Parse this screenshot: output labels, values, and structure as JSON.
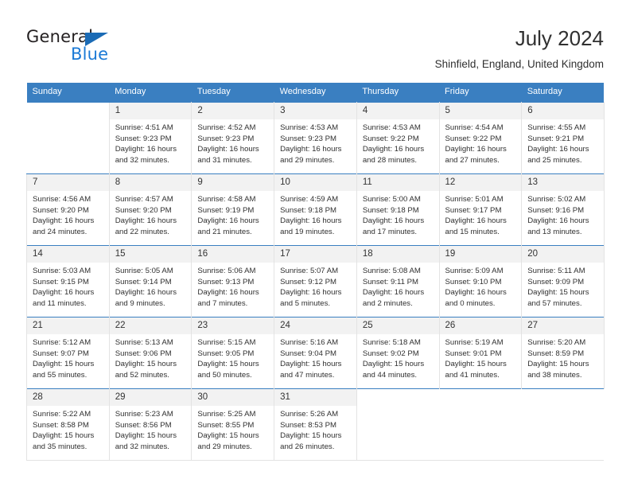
{
  "brand": {
    "word_one": "General",
    "word_two": "Blue",
    "triangle_icon": "brand-triangle-icon",
    "blue": "#1b7ad6",
    "triangle_blue": "#1b6bb5"
  },
  "header": {
    "title": "July 2024",
    "subtitle": "Shinfield, England, United Kingdom"
  },
  "theme": {
    "header_bg": "#3a7fc1",
    "daynum_bg": "#f2f2f2",
    "cell_border": "#e3e3e3",
    "text": "#303030"
  },
  "weekday_headers": [
    "Sunday",
    "Monday",
    "Tuesday",
    "Wednesday",
    "Thursday",
    "Friday",
    "Saturday"
  ],
  "weeks": [
    [
      {
        "day": "",
        "sunrise": "",
        "sunset": "",
        "daylight": ""
      },
      {
        "day": "1",
        "sunrise": "Sunrise: 4:51 AM",
        "sunset": "Sunset: 9:23 PM",
        "daylight": "Daylight: 16 hours and 32 minutes."
      },
      {
        "day": "2",
        "sunrise": "Sunrise: 4:52 AM",
        "sunset": "Sunset: 9:23 PM",
        "daylight": "Daylight: 16 hours and 31 minutes."
      },
      {
        "day": "3",
        "sunrise": "Sunrise: 4:53 AM",
        "sunset": "Sunset: 9:23 PM",
        "daylight": "Daylight: 16 hours and 29 minutes."
      },
      {
        "day": "4",
        "sunrise": "Sunrise: 4:53 AM",
        "sunset": "Sunset: 9:22 PM",
        "daylight": "Daylight: 16 hours and 28 minutes."
      },
      {
        "day": "5",
        "sunrise": "Sunrise: 4:54 AM",
        "sunset": "Sunset: 9:22 PM",
        "daylight": "Daylight: 16 hours and 27 minutes."
      },
      {
        "day": "6",
        "sunrise": "Sunrise: 4:55 AM",
        "sunset": "Sunset: 9:21 PM",
        "daylight": "Daylight: 16 hours and 25 minutes."
      }
    ],
    [
      {
        "day": "7",
        "sunrise": "Sunrise: 4:56 AM",
        "sunset": "Sunset: 9:20 PM",
        "daylight": "Daylight: 16 hours and 24 minutes."
      },
      {
        "day": "8",
        "sunrise": "Sunrise: 4:57 AM",
        "sunset": "Sunset: 9:20 PM",
        "daylight": "Daylight: 16 hours and 22 minutes."
      },
      {
        "day": "9",
        "sunrise": "Sunrise: 4:58 AM",
        "sunset": "Sunset: 9:19 PM",
        "daylight": "Daylight: 16 hours and 21 minutes."
      },
      {
        "day": "10",
        "sunrise": "Sunrise: 4:59 AM",
        "sunset": "Sunset: 9:18 PM",
        "daylight": "Daylight: 16 hours and 19 minutes."
      },
      {
        "day": "11",
        "sunrise": "Sunrise: 5:00 AM",
        "sunset": "Sunset: 9:18 PM",
        "daylight": "Daylight: 16 hours and 17 minutes."
      },
      {
        "day": "12",
        "sunrise": "Sunrise: 5:01 AM",
        "sunset": "Sunset: 9:17 PM",
        "daylight": "Daylight: 16 hours and 15 minutes."
      },
      {
        "day": "13",
        "sunrise": "Sunrise: 5:02 AM",
        "sunset": "Sunset: 9:16 PM",
        "daylight": "Daylight: 16 hours and 13 minutes."
      }
    ],
    [
      {
        "day": "14",
        "sunrise": "Sunrise: 5:03 AM",
        "sunset": "Sunset: 9:15 PM",
        "daylight": "Daylight: 16 hours and 11 minutes."
      },
      {
        "day": "15",
        "sunrise": "Sunrise: 5:05 AM",
        "sunset": "Sunset: 9:14 PM",
        "daylight": "Daylight: 16 hours and 9 minutes."
      },
      {
        "day": "16",
        "sunrise": "Sunrise: 5:06 AM",
        "sunset": "Sunset: 9:13 PM",
        "daylight": "Daylight: 16 hours and 7 minutes."
      },
      {
        "day": "17",
        "sunrise": "Sunrise: 5:07 AM",
        "sunset": "Sunset: 9:12 PM",
        "daylight": "Daylight: 16 hours and 5 minutes."
      },
      {
        "day": "18",
        "sunrise": "Sunrise: 5:08 AM",
        "sunset": "Sunset: 9:11 PM",
        "daylight": "Daylight: 16 hours and 2 minutes."
      },
      {
        "day": "19",
        "sunrise": "Sunrise: 5:09 AM",
        "sunset": "Sunset: 9:10 PM",
        "daylight": "Daylight: 16 hours and 0 minutes."
      },
      {
        "day": "20",
        "sunrise": "Sunrise: 5:11 AM",
        "sunset": "Sunset: 9:09 PM",
        "daylight": "Daylight: 15 hours and 57 minutes."
      }
    ],
    [
      {
        "day": "21",
        "sunrise": "Sunrise: 5:12 AM",
        "sunset": "Sunset: 9:07 PM",
        "daylight": "Daylight: 15 hours and 55 minutes."
      },
      {
        "day": "22",
        "sunrise": "Sunrise: 5:13 AM",
        "sunset": "Sunset: 9:06 PM",
        "daylight": "Daylight: 15 hours and 52 minutes."
      },
      {
        "day": "23",
        "sunrise": "Sunrise: 5:15 AM",
        "sunset": "Sunset: 9:05 PM",
        "daylight": "Daylight: 15 hours and 50 minutes."
      },
      {
        "day": "24",
        "sunrise": "Sunrise: 5:16 AM",
        "sunset": "Sunset: 9:04 PM",
        "daylight": "Daylight: 15 hours and 47 minutes."
      },
      {
        "day": "25",
        "sunrise": "Sunrise: 5:18 AM",
        "sunset": "Sunset: 9:02 PM",
        "daylight": "Daylight: 15 hours and 44 minutes."
      },
      {
        "day": "26",
        "sunrise": "Sunrise: 5:19 AM",
        "sunset": "Sunset: 9:01 PM",
        "daylight": "Daylight: 15 hours and 41 minutes."
      },
      {
        "day": "27",
        "sunrise": "Sunrise: 5:20 AM",
        "sunset": "Sunset: 8:59 PM",
        "daylight": "Daylight: 15 hours and 38 minutes."
      }
    ],
    [
      {
        "day": "28",
        "sunrise": "Sunrise: 5:22 AM",
        "sunset": "Sunset: 8:58 PM",
        "daylight": "Daylight: 15 hours and 35 minutes."
      },
      {
        "day": "29",
        "sunrise": "Sunrise: 5:23 AM",
        "sunset": "Sunset: 8:56 PM",
        "daylight": "Daylight: 15 hours and 32 minutes."
      },
      {
        "day": "30",
        "sunrise": "Sunrise: 5:25 AM",
        "sunset": "Sunset: 8:55 PM",
        "daylight": "Daylight: 15 hours and 29 minutes."
      },
      {
        "day": "31",
        "sunrise": "Sunrise: 5:26 AM",
        "sunset": "Sunset: 8:53 PM",
        "daylight": "Daylight: 15 hours and 26 minutes."
      },
      {
        "day": "",
        "sunrise": "",
        "sunset": "",
        "daylight": ""
      },
      {
        "day": "",
        "sunrise": "",
        "sunset": "",
        "daylight": ""
      },
      {
        "day": "",
        "sunrise": "",
        "sunset": "",
        "daylight": ""
      }
    ]
  ]
}
